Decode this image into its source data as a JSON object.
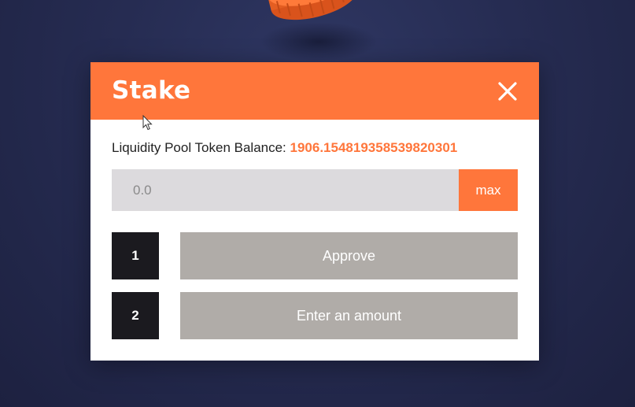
{
  "modal": {
    "title": "Stake",
    "close_icon": "close-icon"
  },
  "balance": {
    "label": "Liquidity Pool Token Balance: ",
    "value": "1906.154819358539820301"
  },
  "amount_input": {
    "placeholder": "0.0",
    "value": ""
  },
  "max_button": {
    "label": "max"
  },
  "steps": [
    {
      "number": "1",
      "label": "Approve"
    },
    {
      "number": "2",
      "label": "Enter an amount"
    }
  ],
  "colors": {
    "accent": "#ff763b",
    "background": "#262c52",
    "step_number_bg": "#1b1a1f",
    "step_button_bg": "#b0aca8",
    "input_bg": "#dcdadd"
  }
}
